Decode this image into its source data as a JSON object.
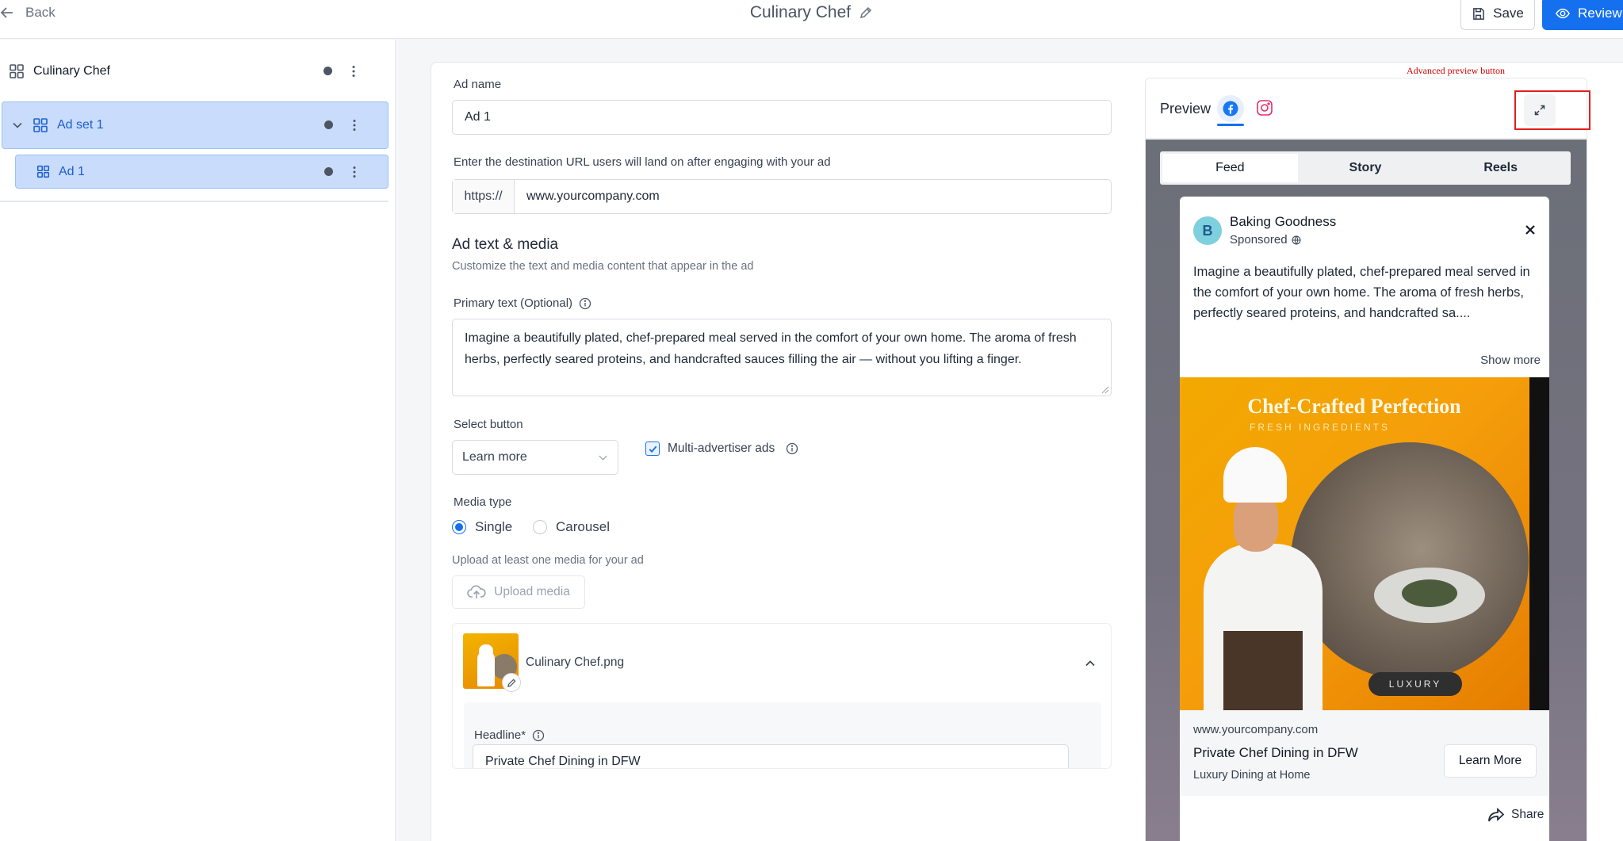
{
  "topbar": {
    "back_label": "Back",
    "title": "Culinary Chef",
    "save_label": "Save",
    "review_label": "Review"
  },
  "sidebar": {
    "root": {
      "label": "Culinary Chef"
    },
    "ad_set": {
      "label": "Ad set 1",
      "expanded": true
    },
    "ad": {
      "label": "Ad 1",
      "selected": true
    }
  },
  "editor": {
    "ad_name_label": "Ad name",
    "ad_name_value": "Ad 1",
    "url_label": "Enter the destination URL users will land on after engaging with your ad",
    "url_prefix": "https://",
    "url_value": "www.yourcompany.com",
    "section_title": "Ad text & media",
    "section_subtitle": "Customize the text and media content that appear in the ad",
    "primary_text_label": "Primary text (Optional)",
    "primary_text_value": "Imagine a beautifully plated, chef-prepared meal served in the comfort of your own home. The aroma of fresh herbs, perfectly seared proteins, and handcrafted sauces filling the air — without you lifting a finger.",
    "select_button_label": "Select button",
    "select_button_value": "Learn more",
    "multi_advertiser_label": "Multi-advertiser ads",
    "multi_advertiser_checked": true,
    "media_type_label": "Media type",
    "media_type_options": [
      "Single",
      "Carousel"
    ],
    "media_type_selected": "Single",
    "upload_hint": "Upload at least one media for your ad",
    "upload_button_label": "Upload media",
    "media_file_name": "Culinary Chef.png",
    "headline_label": "Headline*",
    "headline_value": "Private Chef Dining in DFW"
  },
  "preview": {
    "label": "Preview",
    "platforms": [
      "facebook-icon",
      "instagram-icon"
    ],
    "active_platform": "facebook",
    "placements": [
      "Feed",
      "Story",
      "Reels"
    ],
    "active_placement": "Feed",
    "post": {
      "avatar_letter": "B",
      "page_name": "Baking Goodness",
      "sponsored_label": "Sponsored",
      "text": "Imagine a beautifully plated, chef-prepared meal served in the comfort of your own home. The aroma of fresh herbs, perfectly seared proteins, and handcrafted sa....",
      "show_more_label": "Show more",
      "image_title": "Chef-Crafted Perfection",
      "image_subtitle": "FRESH INGREDIENTS",
      "image_badge": "LUXURY",
      "link_url": "www.yourcompany.com",
      "headline": "Private Chef Dining in DFW",
      "description": "Luxury Dining at Home",
      "cta_label": "Learn More",
      "share_label": "Share"
    }
  },
  "annotation": {
    "label": "Advanced preview button",
    "color": "#e02020"
  },
  "colors": {
    "primary": "#1570ef",
    "selected_row_bg": "#c9dcfb",
    "selected_row_text": "#1d5fd1"
  }
}
